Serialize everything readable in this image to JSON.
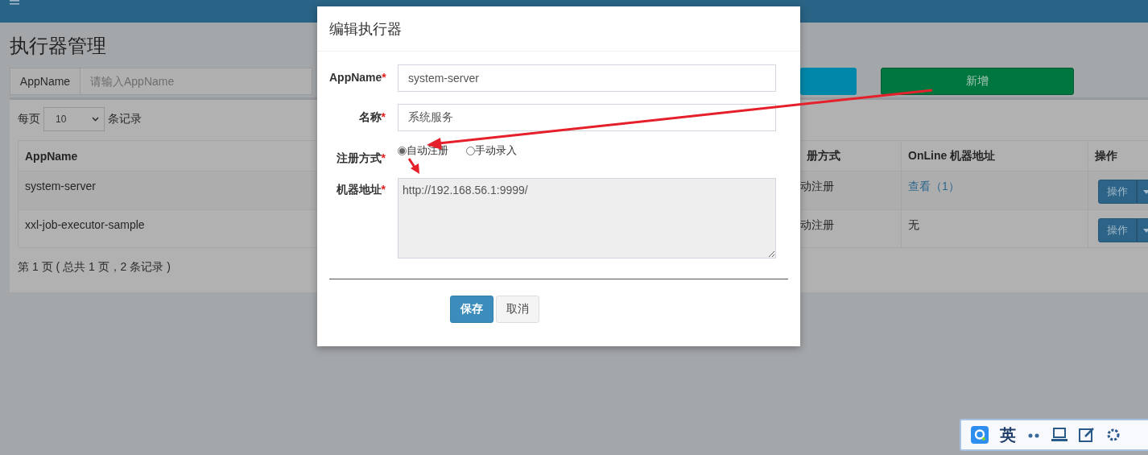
{
  "page_title": "执行器管理",
  "search": {
    "label": "AppName",
    "placeholder": "请输入AppName"
  },
  "add_button": "新增",
  "page_size": {
    "prefix": "每页",
    "value": "10",
    "suffix": "条记录"
  },
  "table": {
    "columns": [
      "AppName",
      "册方式",
      "OnLine 机器地址",
      "操作"
    ],
    "rows": [
      {
        "app_name": "system-server",
        "column_2": "动注册",
        "online": {
          "kind": "link",
          "text": "查看（1）"
        },
        "action": "操作"
      },
      {
        "app_name": "xxl-job-executor-sample",
        "column_2": "动注册",
        "online": {
          "kind": "text",
          "text": "无"
        },
        "action": "操作"
      }
    ]
  },
  "pagination": "第 1 页 ( 总共 1 页，2 条记录 )",
  "modal": {
    "title": "编辑执行器",
    "fields": [
      {
        "kind": "input",
        "label": "AppName",
        "required_mark": "*",
        "value": "system-server"
      },
      {
        "kind": "input",
        "label": "名称",
        "required_mark": "*",
        "value": "系统服务"
      },
      {
        "kind": "radio",
        "label": "注册方式",
        "required_mark": "*",
        "options": [
          {
            "label": "自动注册",
            "selected": true
          },
          {
            "label": "手动录入",
            "selected": false
          }
        ]
      },
      {
        "kind": "textarea",
        "label": "机器地址",
        "required_mark": "*",
        "value": "http://192.168.56.1:9999/",
        "disabled": true
      }
    ],
    "buttons": [
      {
        "kind": "primary",
        "label": "保存"
      },
      {
        "kind": "default",
        "label": "取消"
      }
    ]
  },
  "ime": {
    "language": "英"
  }
}
